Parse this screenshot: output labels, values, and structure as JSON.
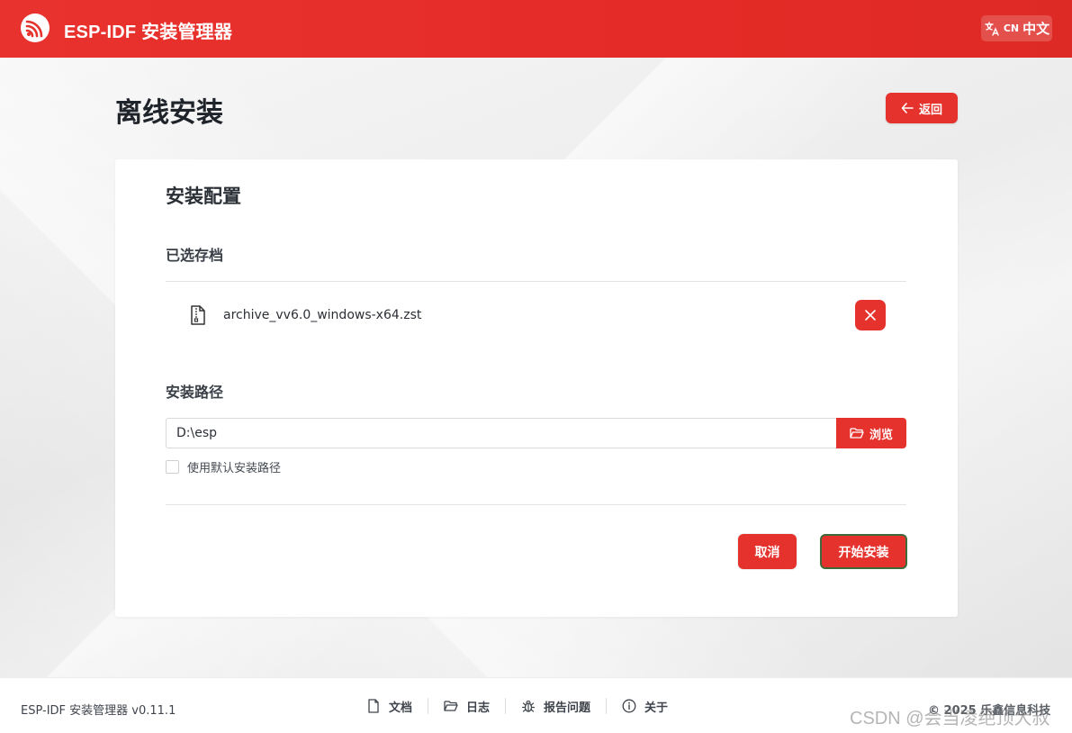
{
  "header": {
    "app_title": "ESP-IDF 安装管理器",
    "logo_icon": "espressif-logo-icon",
    "language": {
      "icon": "translate-icon",
      "code": "CN",
      "label": "中文"
    }
  },
  "page": {
    "title": "离线安装",
    "back_label": "返回",
    "back_icon": "arrow-left-icon"
  },
  "card": {
    "title": "安装配置",
    "archive_section": {
      "label": "已选存档",
      "file_icon": "archive-file-icon",
      "file_name": "archive_vv6.0_windows-x64.zst",
      "remove_icon": "close-icon"
    },
    "path_section": {
      "label": "安装路径",
      "value": "D:\\esp",
      "browse_label": "浏览",
      "browse_icon": "folder-open-icon",
      "default_path_checkbox": {
        "label": "使用默认安装路径",
        "checked": false
      }
    },
    "actions": {
      "cancel_label": "取消",
      "start_label": "开始安装"
    }
  },
  "footer": {
    "version": "ESP-IDF 安装管理器 v0.11.1",
    "links": [
      {
        "label": "文档",
        "icon": "document-icon"
      },
      {
        "label": "日志",
        "icon": "folder-icon"
      },
      {
        "label": "报告问题",
        "icon": "bug-icon"
      },
      {
        "label": "关于",
        "icon": "info-icon"
      }
    ],
    "copyright": "© 2025 乐鑫信息科技"
  },
  "watermark": "CSDN @会当凌绝顶大叔",
  "colors": {
    "brand_red": "#e5322d",
    "text_dark": "#2b2f36"
  }
}
